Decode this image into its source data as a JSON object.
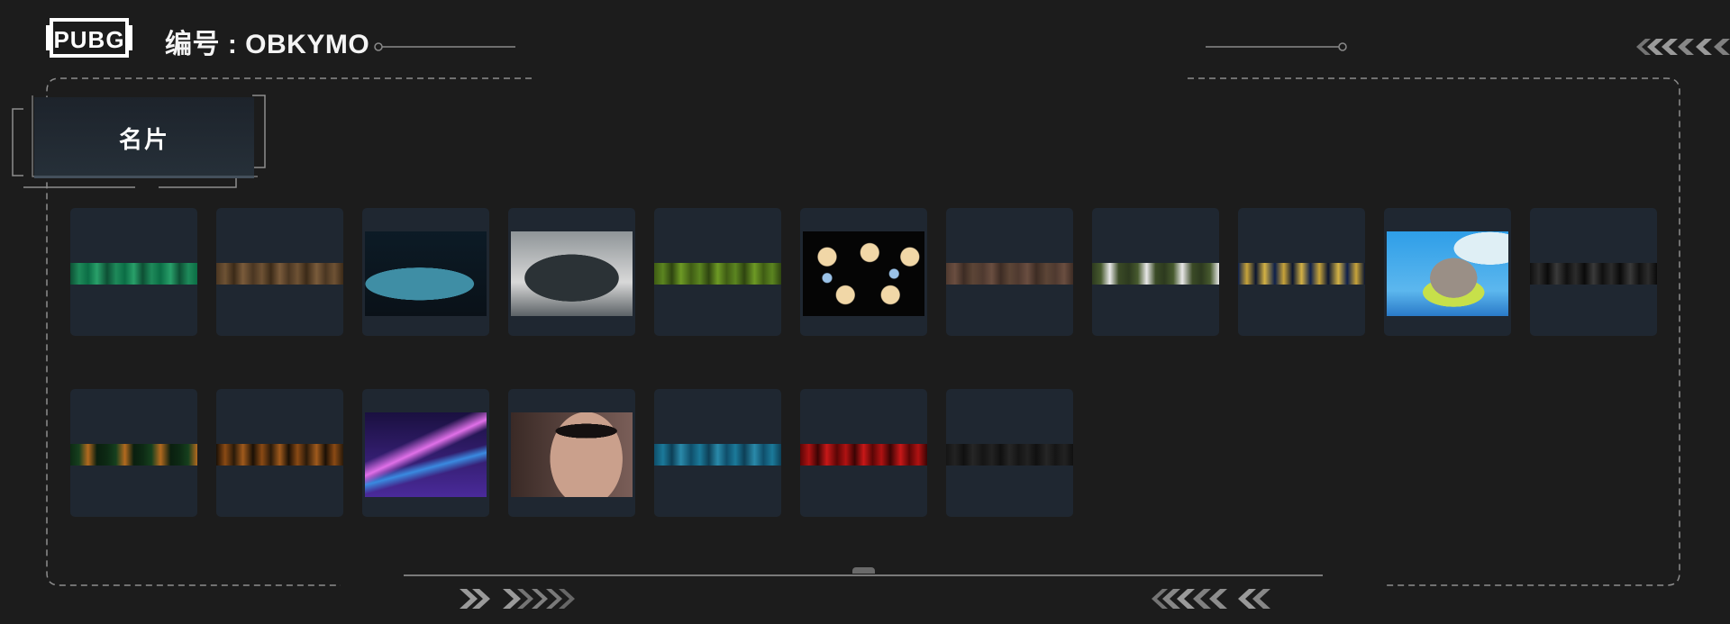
{
  "header": {
    "logo_text": "PUBG",
    "label": "编号 : ",
    "player_id": "OBKYMO"
  },
  "tab": {
    "label": "名片"
  },
  "cards": [
    {
      "kind": "strip",
      "name": "green-camo",
      "colors": [
        "#0d4f34",
        "#1e8a5a",
        "#0b6d45",
        "#29a06a"
      ]
    },
    {
      "kind": "strip",
      "name": "brown-pattern",
      "colors": [
        "#4a3622",
        "#6e5234",
        "#3b2a18",
        "#7a5b3b"
      ]
    },
    {
      "kind": "image",
      "name": "blue-sports-car",
      "colors": [
        "#0c1b26",
        "#3f8ea5",
        "#0a1118"
      ]
    },
    {
      "kind": "image",
      "name": "dark-supercar",
      "colors": [
        "#d8d8d8",
        "#2b3236",
        "#8f9598"
      ]
    },
    {
      "kind": "strip",
      "name": "green-scales",
      "colors": [
        "#3f5c14",
        "#5b8520",
        "#2e4410",
        "#6d9a25"
      ]
    },
    {
      "kind": "image",
      "name": "anime-girls-pattern",
      "colors": [
        "#050505",
        "#f1d7a7",
        "#9ac2e8"
      ]
    },
    {
      "kind": "strip",
      "name": "brown-paws",
      "colors": [
        "#4f3a30",
        "#6a4e40",
        "#3d2c24",
        "#5c4536"
      ]
    },
    {
      "kind": "strip",
      "name": "shark-mouth",
      "colors": [
        "#2d3a1f",
        "#475a2e",
        "#e8e8e8",
        "#3a4a26"
      ]
    },
    {
      "kind": "strip",
      "name": "blue-yellow-camo",
      "colors": [
        "#0d1f4a",
        "#c7a33a",
        "#0a1530",
        "#d4b245"
      ]
    },
    {
      "kind": "image",
      "name": "seal-on-float",
      "colors": [
        "#2e9ee8",
        "#dfeff5",
        "#c7e04a"
      ]
    },
    {
      "kind": "strip",
      "name": "black-zigzag",
      "colors": [
        "#101010",
        "#2c2c2c",
        "#0a0a0a",
        "#3a3a3a"
      ]
    },
    {
      "kind": "strip",
      "name": "jungle-eye",
      "colors": [
        "#0d2a14",
        "#16401e",
        "#b36a1f",
        "#0a1f0f"
      ]
    },
    {
      "kind": "strip",
      "name": "tiger-stripes",
      "colors": [
        "#1a1006",
        "#8a4a14",
        "#2a1a0a",
        "#a05a1c"
      ]
    },
    {
      "kind": "image",
      "name": "neon-guitar",
      "colors": [
        "#4a2a9a",
        "#e070e8",
        "#3a8ae0"
      ]
    },
    {
      "kind": "image",
      "name": "woman-sunglasses",
      "colors": [
        "#3a2a26",
        "#caa08c",
        "#7a5e58"
      ]
    },
    {
      "kind": "strip",
      "name": "teal-mountains",
      "colors": [
        "#0f4e6a",
        "#1b7a9a",
        "#0d3f56",
        "#2a8aaa"
      ]
    },
    {
      "kind": "strip",
      "name": "red-diamonds",
      "colors": [
        "#5a0606",
        "#b01212",
        "#3a0404",
        "#c81818"
      ]
    },
    {
      "kind": "strip",
      "name": "dark-texture",
      "colors": [
        "#151515",
        "#222222",
        "#101010",
        "#262626"
      ]
    }
  ]
}
